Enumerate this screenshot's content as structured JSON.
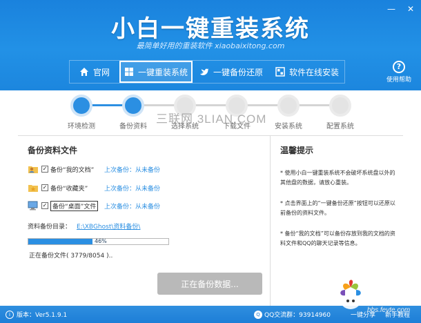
{
  "window": {
    "title": "小白一键重装系统",
    "subtitle": "最简单好用的重装软件 xiaobaixitong.com",
    "controls": {
      "minimize": "—",
      "close": "✕"
    }
  },
  "nav": {
    "items": [
      {
        "label": "官网",
        "icon": "home-icon"
      },
      {
        "label": "一键重装系统",
        "icon": "windows-icon"
      },
      {
        "label": "一键备份还原",
        "icon": "bird-icon"
      },
      {
        "label": "软件在线安装",
        "icon": "apps-icon"
      }
    ],
    "active_index": 1,
    "help_label": "使用帮助"
  },
  "steps": {
    "items": [
      {
        "label": "环境检测",
        "done": true
      },
      {
        "label": "备份资料",
        "done": true
      },
      {
        "label": "选择系统",
        "done": false
      },
      {
        "label": "下载文件",
        "done": false
      },
      {
        "label": "安装系统",
        "done": false
      },
      {
        "label": "配置系统",
        "done": false
      }
    ],
    "watermark": "三联网 3LIAN.COM"
  },
  "backup": {
    "title": "备份资料文件",
    "items": [
      {
        "label": "备份“我的文档”",
        "checked": true,
        "status": "上次备份：从未备份",
        "icon": "user-folder-icon",
        "boxed": false
      },
      {
        "label": "备份“收藏夹”",
        "checked": true,
        "status": "上次备份：从未备份",
        "icon": "favorites-folder-icon",
        "boxed": false
      },
      {
        "label": "备份“桌面”文件",
        "checked": true,
        "status": "上次备份：从未备份",
        "icon": "desktop-icon",
        "boxed": true
      }
    ],
    "directory_label": "资料备份目录：",
    "directory_path": "E:\\XBGhost\\资料备份\\",
    "progress_text": "46%",
    "progress_fraction": 0.46,
    "status_text": "正在备份文件( 3779/8054 )..",
    "action_label": "正在备份数据..."
  },
  "tips": {
    "title": "温馨提示",
    "items": [
      "* 使用小白一键重装系统不会破坏系统盘以外的其他盘的数据，请放心重装。",
      "* 点击界面上的“一键备份还原”按钮可以还原以前备份的资料文件。",
      "* 备份“我的文档”可以备份存放到我的文档的资料文件和QQ的聊天记录等信息。"
    ]
  },
  "footer": {
    "version": "版本：Ver5.1.9.1",
    "qq_group": "QQ交流群：93914960",
    "share_label": "一键分享",
    "tutorial_label": "新手教程",
    "site_text": "bbs.fevte.com"
  },
  "colors": {
    "header": "#2291e6",
    "accent": "#2b8fe2",
    "action_disabled": "#b9b9b9"
  }
}
